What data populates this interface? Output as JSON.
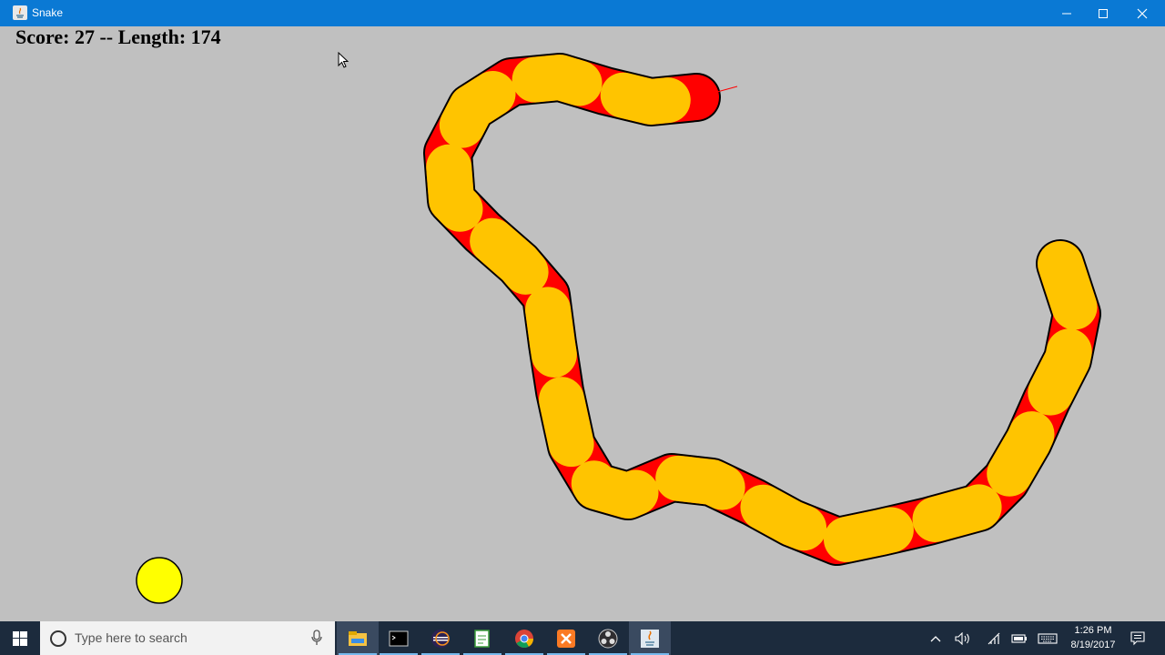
{
  "window": {
    "title": "Snake"
  },
  "game": {
    "score_text": "Score: 27 -- Length: 174",
    "colors": {
      "background": "#c0c0c0",
      "segment_a": "#ff0000",
      "segment_b": "#ffc400",
      "food": "#ffff00",
      "outline": "#000000"
    }
  },
  "taskbar": {
    "search_placeholder": "Type here to search",
    "apps": [
      "file-explorer-icon",
      "terminal-icon",
      "eclipse-icon",
      "notepad-icon",
      "chrome-icon",
      "xampp-icon",
      "obs-icon",
      "java-icon"
    ],
    "tray": [
      "chevron-up-icon",
      "volume-icon",
      "network-icon",
      "battery-icon",
      "keyboard-icon"
    ],
    "time": "1:26 PM",
    "date": "8/19/2017",
    "notification_icon": "action-center-icon"
  }
}
